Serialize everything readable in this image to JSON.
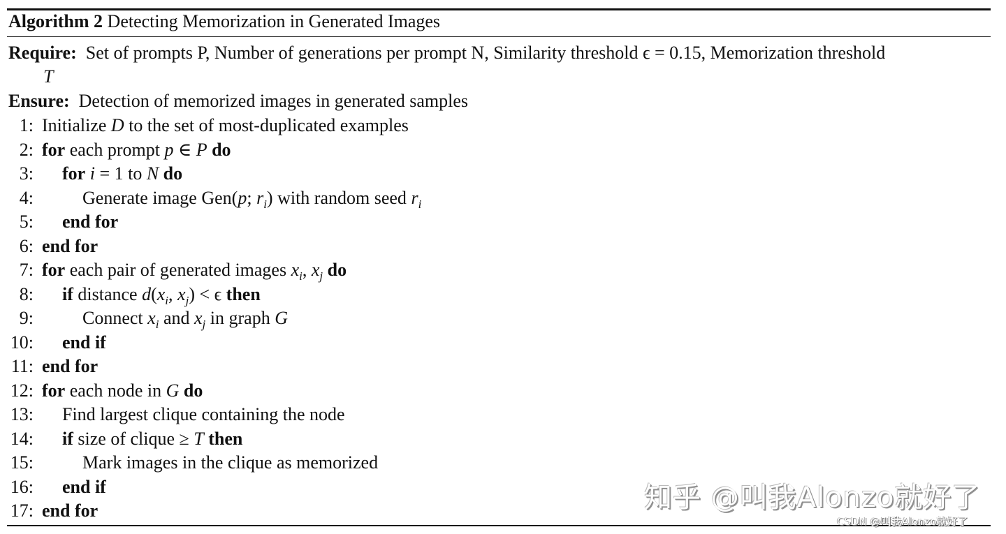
{
  "algorithm": {
    "label": "Algorithm 2",
    "title": "Detecting Memorization in Generated Images",
    "require_label": "Require:",
    "require_text": "Set of prompts P, Number of generations per prompt N, Similarity threshold ϵ = 0.15, Memorization threshold",
    "require_cont": "T",
    "ensure_label": "Ensure:",
    "ensure_text": "Detection of memorized images in generated samples",
    "lines": [
      {
        "n": "1:",
        "indent": 0,
        "parts": [
          [
            "t",
            "Initialize "
          ],
          [
            "m",
            "D"
          ],
          [
            "t",
            " to the set of most-duplicated examples"
          ]
        ]
      },
      {
        "n": "2:",
        "indent": 0,
        "parts": [
          [
            "k",
            "for"
          ],
          [
            "t",
            " each prompt "
          ],
          [
            "m",
            "p"
          ],
          [
            "t",
            " ∈ "
          ],
          [
            "m",
            "P"
          ],
          [
            "t",
            " "
          ],
          [
            "k",
            "do"
          ]
        ]
      },
      {
        "n": "3:",
        "indent": 1,
        "parts": [
          [
            "k",
            "for"
          ],
          [
            "t",
            " "
          ],
          [
            "m",
            "i"
          ],
          [
            "t",
            " = 1 to "
          ],
          [
            "m",
            "N"
          ],
          [
            "t",
            " "
          ],
          [
            "k",
            "do"
          ]
        ]
      },
      {
        "n": "4:",
        "indent": 2,
        "parts": [
          [
            "t",
            "Generate image Gen("
          ],
          [
            "m",
            "p"
          ],
          [
            "t",
            "; "
          ],
          [
            "m",
            "r"
          ],
          [
            "s",
            "i"
          ],
          [
            "t",
            ") with random seed "
          ],
          [
            "m",
            "r"
          ],
          [
            "s",
            "i"
          ]
        ]
      },
      {
        "n": "5:",
        "indent": 1,
        "parts": [
          [
            "k",
            "end for"
          ]
        ]
      },
      {
        "n": "6:",
        "indent": 0,
        "parts": [
          [
            "k",
            "end for"
          ]
        ]
      },
      {
        "n": "7:",
        "indent": 0,
        "parts": [
          [
            "k",
            "for"
          ],
          [
            "t",
            " each pair of generated images "
          ],
          [
            "m",
            "x"
          ],
          [
            "s",
            "i"
          ],
          [
            "t",
            ", "
          ],
          [
            "m",
            "x"
          ],
          [
            "s",
            "j"
          ],
          [
            "t",
            " "
          ],
          [
            "k",
            "do"
          ]
        ]
      },
      {
        "n": "8:",
        "indent": 1,
        "parts": [
          [
            "k",
            "if"
          ],
          [
            "t",
            " distance "
          ],
          [
            "m",
            "d"
          ],
          [
            "t",
            "("
          ],
          [
            "m",
            "x"
          ],
          [
            "s",
            "i"
          ],
          [
            "t",
            ", "
          ],
          [
            "m",
            "x"
          ],
          [
            "s",
            "j"
          ],
          [
            "t",
            ") < ϵ "
          ],
          [
            "k",
            "then"
          ]
        ]
      },
      {
        "n": "9:",
        "indent": 2,
        "parts": [
          [
            "t",
            "Connect "
          ],
          [
            "m",
            "x"
          ],
          [
            "s",
            "i"
          ],
          [
            "t",
            " and "
          ],
          [
            "m",
            "x"
          ],
          [
            "s",
            "j"
          ],
          [
            "t",
            " in graph "
          ],
          [
            "m",
            "G"
          ]
        ]
      },
      {
        "n": "10:",
        "indent": 1,
        "parts": [
          [
            "k",
            "end if"
          ]
        ]
      },
      {
        "n": "11:",
        "indent": 0,
        "parts": [
          [
            "k",
            "end for"
          ]
        ]
      },
      {
        "n": "12:",
        "indent": 0,
        "parts": [
          [
            "k",
            "for"
          ],
          [
            "t",
            " each node in "
          ],
          [
            "m",
            "G"
          ],
          [
            "t",
            " "
          ],
          [
            "k",
            "do"
          ]
        ]
      },
      {
        "n": "13:",
        "indent": 1,
        "parts": [
          [
            "t",
            "Find largest clique containing the node"
          ]
        ]
      },
      {
        "n": "14:",
        "indent": 1,
        "parts": [
          [
            "k",
            "if"
          ],
          [
            "t",
            " size of clique ≥ "
          ],
          [
            "m",
            "T"
          ],
          [
            "t",
            " "
          ],
          [
            "k",
            "then"
          ]
        ]
      },
      {
        "n": "15:",
        "indent": 2,
        "parts": [
          [
            "t",
            "Mark images in the clique as memorized"
          ]
        ]
      },
      {
        "n": "16:",
        "indent": 1,
        "parts": [
          [
            "k",
            "end if"
          ]
        ]
      },
      {
        "n": "17:",
        "indent": 0,
        "parts": [
          [
            "k",
            "end for"
          ]
        ]
      }
    ]
  },
  "watermark": {
    "zhihu": "知乎 @叫我Alonzo就好了",
    "csdn": "CSDN @叫我Alonzo就好了"
  }
}
